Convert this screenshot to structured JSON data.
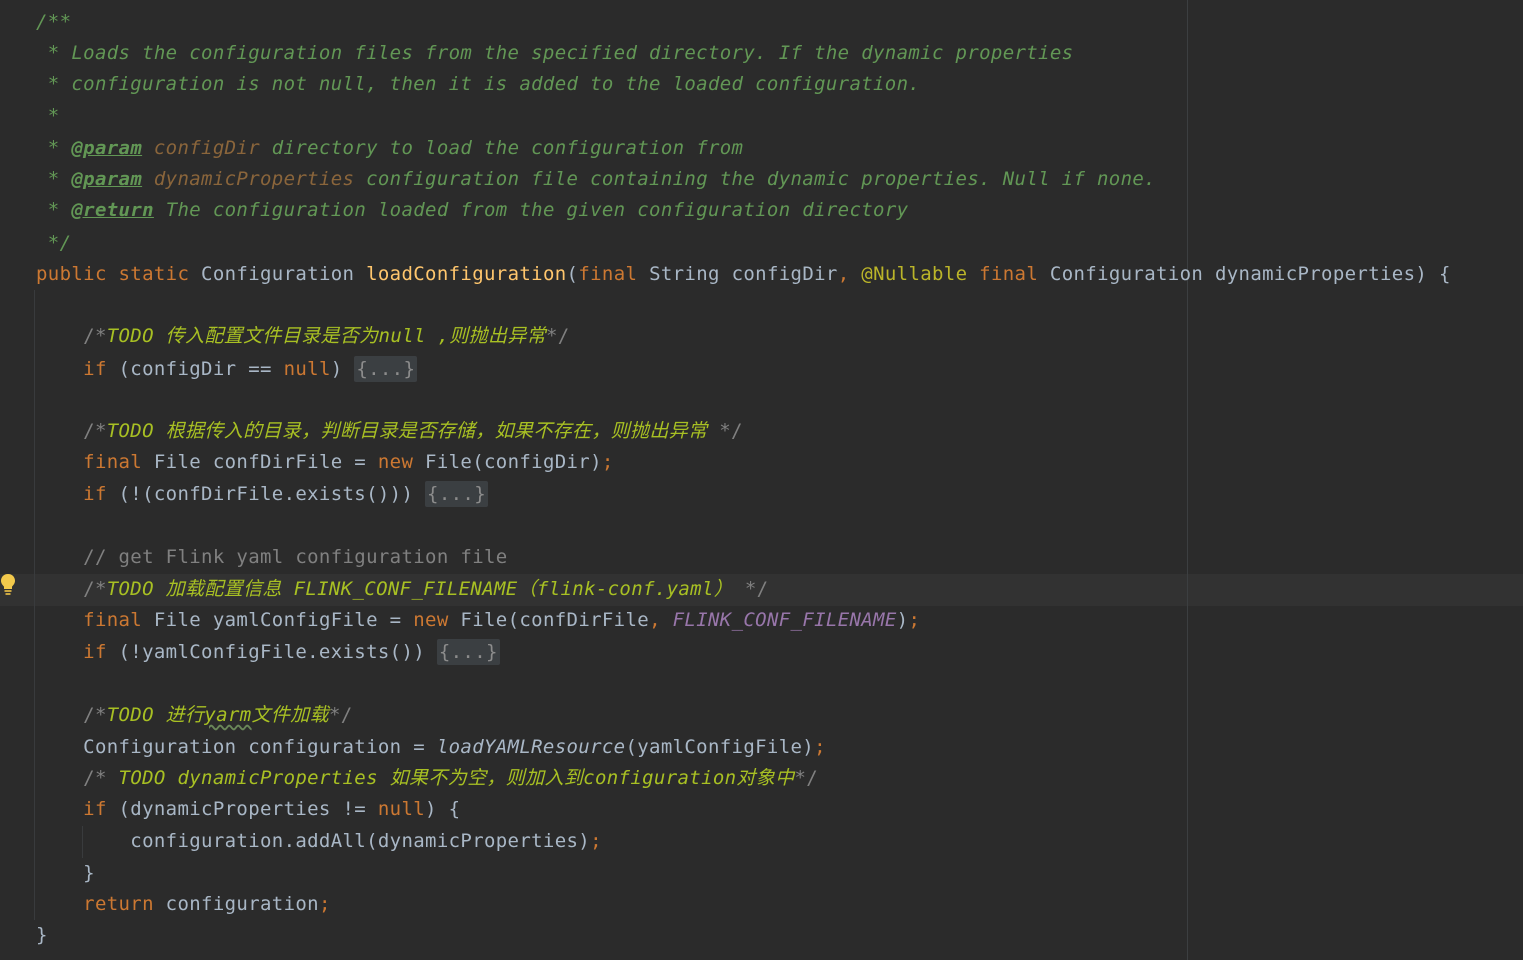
{
  "editor": {
    "lines": {
      "doc_open": "/**",
      "doc_line1": " * Loads the configuration files from the specified directory. If the dynamic properties",
      "doc_line2": " * configuration is not null, then it is added to the loaded configuration.",
      "doc_line3": " *",
      "doc_param1_prefix": " * ",
      "doc_param1_tag": "@param",
      "doc_param1_name": " configDir",
      "doc_param1_desc": " directory to load the configuration from",
      "doc_param2_prefix": " * ",
      "doc_param2_tag": "@param",
      "doc_param2_name": " dynamicProperties",
      "doc_param2_desc": " configuration file containing the dynamic properties. Null if none.",
      "doc_return_prefix": " * ",
      "doc_return_tag": "@return",
      "doc_return_desc": " The configuration loaded from the given configuration directory",
      "doc_close": " */",
      "sig_public": "public",
      "sig_static": " static",
      "sig_type": " Configuration ",
      "sig_name": "loadConfiguration",
      "sig_open": "(",
      "sig_final1": "final",
      "sig_p1": " String configDir",
      "sig_comma": ",",
      "sig_ann": " @Nullable",
      "sig_final2": " final",
      "sig_p2": " Configuration dynamicProperties) {",
      "todo1_open": "    /*",
      "todo1_text": "TODO 传入配置文件目录是否为null ,则抛出异常",
      "todo1_close": "*/",
      "if1_kw": "    if",
      "if1_cond": " (configDir == ",
      "if1_null": "null",
      "if1_paren": ") ",
      "if1_fold": "{...}",
      "todo2_open": "    /*",
      "todo2_text": "TODO 根据传入的目录，判断目录是否存储，如果不存在，则抛出异常",
      "todo2_close": " */",
      "final1_kw": "    final",
      "final1_mid": " File confDirFile = ",
      "final1_new": "new",
      "final1_rest": " File(configDir)",
      "final1_semi": ";",
      "if2_kw": "    if",
      "if2_cond": " (!(confDirFile.exists())) ",
      "if2_fold": "{...}",
      "comment_get": "    // get Flink yaml configuration file",
      "todo3_open": "    /*",
      "todo3_text": "TODO 加载配置信息 FLINK_CONF_FILENAME（flink-conf.yaml）",
      "todo3_close": " */",
      "final2_kw": "    final",
      "final2_mid": " File yamlConfigFile = ",
      "final2_new": "new",
      "final2_call": " File(confDirFile",
      "final2_comma": ",",
      "final2_const": " FLINK_CONF_FILENAME",
      "final2_close": ")",
      "final2_semi": ";",
      "if3_kw": "    if",
      "if3_cond": " (!yamlConfigFile.exists()) ",
      "if3_fold": "{...}",
      "todo4_open": "    /*",
      "todo4_text_a": "TODO 进行",
      "todo4_text_b": "yarm",
      "todo4_text_c": "文件加载",
      "todo4_close": "*/",
      "conf_decl": "    Configuration configuration = ",
      "conf_call": "loadYAMLResource",
      "conf_args": "(yamlConfigFile)",
      "conf_semi": ";",
      "todo5_open": "    /* ",
      "todo5_text": "TODO dynamicProperties 如果不为空，则加入到configuration对象中",
      "todo5_close": "*/",
      "if4_kw": "    if",
      "if4_cond": " (dynamicProperties != ",
      "if4_null": "null",
      "if4_brace": ") {",
      "addall": "        configuration.addAll(dynamicProperties)",
      "addall_semi": ";",
      "close_if": "    }",
      "ret_kw": "    return",
      "ret_val": " configuration",
      "ret_semi": ";",
      "close_method": "}"
    },
    "intention_icon": "lightbulb-icon"
  },
  "colors": {
    "background": "#2b2b2b",
    "keyword": "#cc7832",
    "doc_comment": "#629755",
    "todo": "#a8c023",
    "constant": "#9876aa",
    "method_decl": "#ffc66d",
    "annotation": "#bbb529",
    "line_comment": "#808080",
    "default_text": "#a9b7c6"
  }
}
